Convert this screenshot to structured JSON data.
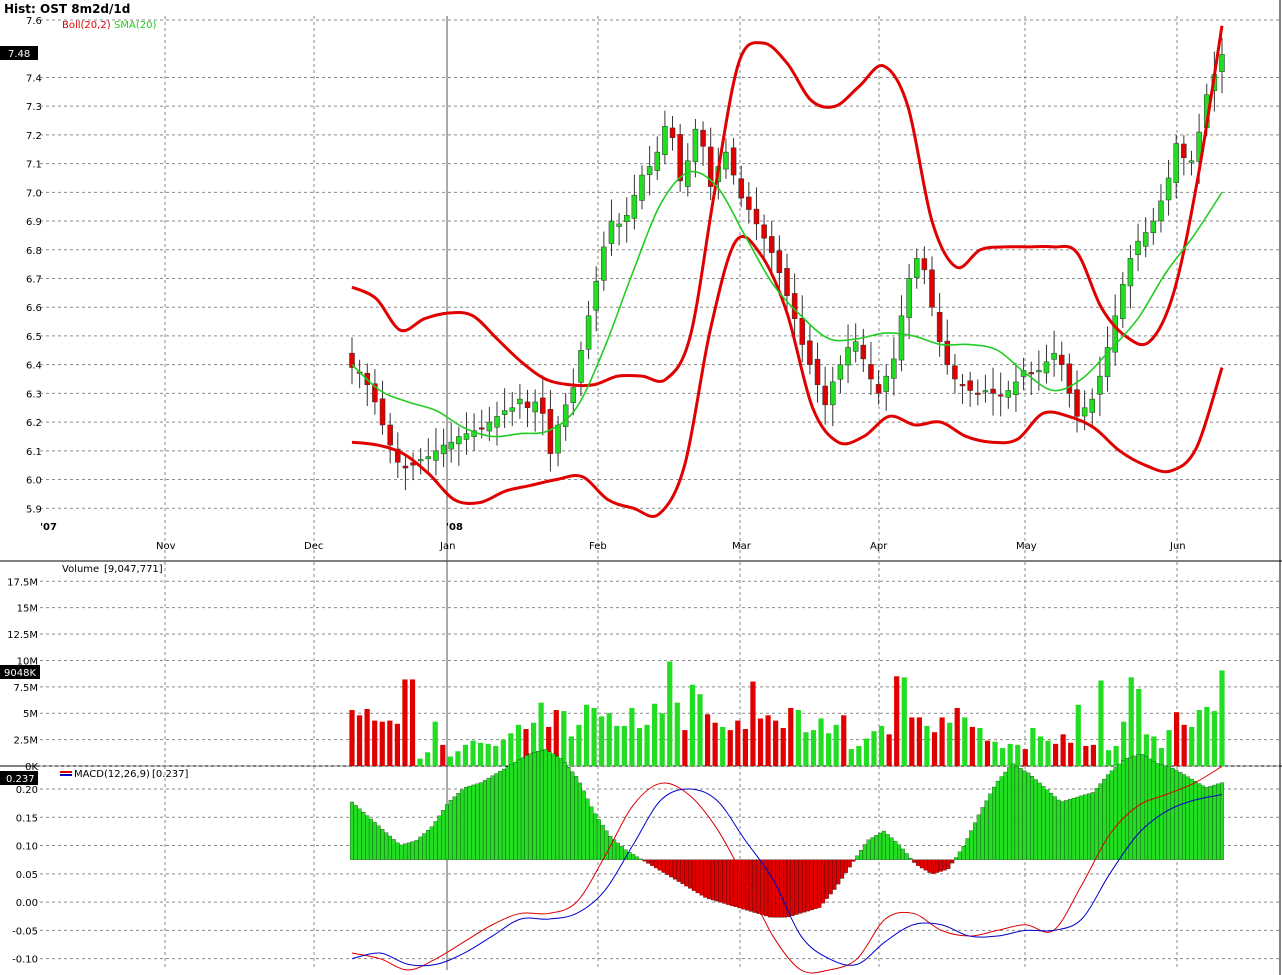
{
  "window": {
    "title": "Hist: OST 8m2d/1d"
  },
  "price_panel": {
    "legend": [
      {
        "label": "Boll(20,2)",
        "color": "#e00000"
      },
      {
        "label": "SMA(20)",
        "color": "#22cc22"
      }
    ],
    "last_value_badge": "7.48",
    "y_ticks": [
      "7.6",
      "7.4",
      "7.3",
      "7.2",
      "7.1",
      "7.0",
      "6.9",
      "6.8",
      "6.7",
      "6.6",
      "6.5",
      "6.4",
      "6.3",
      "6.2",
      "6.1",
      "6.0",
      "5.9"
    ]
  },
  "volume_panel": {
    "label": "Volume",
    "value": "[9,047,771]",
    "last_value_badge": "9048K",
    "y_ticks": [
      "17.5M",
      "15M",
      "12.5M",
      "10M",
      "7.5M",
      "5M",
      "2.5M",
      "0K"
    ]
  },
  "macd_panel": {
    "label": "MACD(12,26,9)",
    "value": "[0.237]",
    "last_value_badge": "0.237",
    "y_ticks": [
      "0.20",
      "0.15",
      "0.10",
      "0.05",
      "0.00",
      "-0.05",
      "-0.10"
    ]
  },
  "time_axis": {
    "year_labels": [
      "'07",
      "'08"
    ],
    "month_labels": [
      "Nov",
      "Dec",
      "Jan",
      "Feb",
      "Mar",
      "Apr",
      "May",
      "Jun"
    ]
  },
  "colors": {
    "up": "#22dd22",
    "down": "#e00000",
    "boll": "#e00000",
    "sma": "#22cc22",
    "macd": "#0000cc",
    "signal": "#dd0000"
  },
  "chart_data": [
    {
      "type": "candlestick",
      "title": "Hist: OST 8m2d/1d",
      "ylim": [
        5.88,
        7.6
      ],
      "grid": true,
      "x_range": [
        "2007-10-01",
        "2008-06-12"
      ],
      "close": [
        6.39,
        6.37,
        6.33,
        6.27,
        6.19,
        6.12,
        6.06,
        6.04,
        6.05,
        6.07,
        6.08,
        6.1,
        6.12,
        6.13,
        6.15,
        6.16,
        6.17,
        6.18,
        6.2,
        6.22,
        6.24,
        6.25,
        6.28,
        6.25,
        6.27,
        6.23,
        6.09,
        6.19,
        6.26,
        6.32,
        6.45,
        6.57,
        6.69,
        6.81,
        6.9,
        6.89,
        6.92,
        6.99,
        7.06,
        7.09,
        7.14,
        7.23,
        7.19,
        7.04,
        7.11,
        7.22,
        7.16,
        7.02,
        7.09,
        7.14,
        7.06,
        6.98,
        6.94,
        6.89,
        6.84,
        6.79,
        6.72,
        6.64,
        6.56,
        6.47,
        6.4,
        6.33,
        6.26,
        6.34,
        6.4,
        6.46,
        6.48,
        6.42,
        6.35,
        6.3,
        6.36,
        6.42,
        6.57,
        6.7,
        6.77,
        6.73,
        6.6,
        6.48,
        6.4,
        6.35,
        6.33,
        6.31,
        6.3,
        6.31,
        6.3,
        6.29,
        6.31,
        6.34,
        6.38,
        6.37,
        6.38,
        6.41,
        6.44,
        6.4,
        6.3,
        6.22,
        6.25,
        6.28,
        6.36,
        6.46,
        6.57,
        6.68,
        6.77,
        6.83,
        6.86,
        6.9,
        6.97,
        7.05,
        7.17,
        7.12,
        7.11,
        7.21,
        7.34,
        7.41,
        7.48
      ],
      "bollinger_upper": [
        6.67,
        6.63,
        6.52,
        6.56,
        6.58,
        6.57,
        6.49,
        6.41,
        6.35,
        6.33,
        6.33,
        6.36,
        6.36,
        6.35,
        6.5,
        7.0,
        7.45,
        7.52,
        7.45,
        7.32,
        7.3,
        7.37,
        7.44,
        7.3,
        6.9,
        6.74,
        6.8,
        6.81,
        6.81,
        6.81,
        6.79,
        6.6,
        6.5,
        6.48,
        6.65,
        7.05,
        7.58
      ],
      "sma": [
        6.4,
        6.31,
        6.27,
        6.24,
        6.18,
        6.15,
        6.16,
        6.17,
        6.25,
        6.46,
        6.72,
        6.96,
        7.07,
        7.02,
        6.85,
        6.68,
        6.57,
        6.49,
        6.49,
        6.51,
        6.5,
        6.47,
        6.47,
        6.45,
        6.37,
        6.31,
        6.35,
        6.45,
        6.56,
        6.72,
        6.85,
        7.0
      ],
      "bollinger_lower": [
        6.13,
        6.12,
        6.09,
        6.02,
        5.93,
        5.92,
        5.96,
        5.98,
        6.0,
        6.01,
        5.93,
        5.9,
        5.88,
        6.05,
        6.52,
        6.83,
        6.78,
        6.58,
        6.25,
        6.13,
        6.15,
        6.22,
        6.19,
        6.2,
        6.15,
        6.13,
        6.14,
        6.23,
        6.22,
        6.18,
        6.1,
        6.05,
        6.03,
        6.11,
        6.39
      ]
    },
    {
      "type": "bar",
      "title": "Volume",
      "ylim": [
        0,
        18000000
      ],
      "values": [
        5300000,
        4800000,
        5400000,
        4300000,
        4200000,
        4300000,
        4000000,
        8200000,
        8200000,
        700000,
        1300000,
        4200000,
        2000000,
        900000,
        1400000,
        2000000,
        2400000,
        2200000,
        2100000,
        1900000,
        2500000,
        3100000,
        3900000,
        3500000,
        4100000,
        6000000,
        3700000,
        5300000,
        5200000,
        2800000,
        3900000,
        5800000,
        5500000,
        4700000,
        5000000,
        3800000,
        3800000,
        5500000,
        3600000,
        3900000,
        5900000,
        5000000,
        9900000,
        6000000,
        3400000,
        7700000,
        6800000,
        4900000,
        4100000,
        3700000,
        3400000,
        4300000,
        3500000,
        8000000,
        4500000,
        4800000,
        4300000,
        3600000,
        5500000,
        5300000,
        3200000,
        3400000,
        4500000,
        3100000,
        3900000,
        4800000,
        1600000,
        1900000,
        2600000,
        3300000,
        3800000,
        3000000,
        8500000,
        8400000,
        4600000,
        4600000,
        3800000,
        3200000,
        4600000,
        4100000,
        5500000,
        4600000,
        3700000,
        3600000,
        2400000,
        2300000,
        1700000,
        2100000,
        2000000,
        1600000,
        3600000,
        2800000,
        2400000,
        2100000,
        3000000,
        2200000,
        5800000,
        1900000,
        2000000,
        8100000,
        1500000,
        1900000,
        4200000,
        8400000,
        7300000,
        3000000,
        2800000,
        1700000,
        3400000,
        5100000,
        3900000,
        3700000,
        5300000,
        5600000,
        5200000,
        9050000
      ],
      "up_days": [
        false,
        false,
        false,
        false,
        false,
        false,
        false,
        false,
        false,
        true,
        true,
        true,
        false,
        true,
        true,
        true,
        true,
        true,
        true,
        true,
        true,
        true,
        true,
        false,
        true,
        true,
        false,
        false,
        true,
        true,
        true,
        true,
        true,
        true,
        true,
        true,
        true,
        true,
        true,
        true,
        true,
        true,
        true,
        true,
        false,
        true,
        true,
        false,
        false,
        true,
        false,
        false,
        false,
        false,
        false,
        false,
        false,
        false,
        false,
        true,
        true,
        true,
        true,
        true,
        true,
        false,
        true,
        true,
        true,
        true,
        true,
        false,
        false,
        true,
        false,
        false,
        true,
        false,
        false,
        true,
        false,
        true,
        false,
        true,
        false,
        true,
        true,
        true,
        true,
        false,
        true,
        true,
        true,
        false,
        false,
        false,
        true,
        false,
        false,
        true,
        true,
        true,
        true,
        true,
        true,
        true,
        true,
        true,
        true,
        false,
        false,
        true,
        true,
        true,
        true,
        true
      ],
      "last_value": 9047771
    },
    {
      "type": "line",
      "title": "MACD(12,26,9)",
      "ylim": [
        -0.12,
        0.23
      ],
      "series": [
        {
          "name": "MACD(12,26,9)",
          "values": [
            -0.09,
            -0.1,
            -0.12,
            -0.1,
            -0.07,
            -0.04,
            -0.02,
            -0.02,
            0.0,
            0.08,
            0.17,
            0.21,
            0.19,
            0.13,
            0.04,
            -0.06,
            -0.12,
            -0.12,
            -0.1,
            -0.03,
            -0.02,
            -0.05,
            -0.06,
            -0.05,
            -0.04,
            -0.05,
            0.03,
            0.12,
            0.17,
            0.19,
            0.21,
            0.24
          ]
        },
        {
          "name": "Signal",
          "values": [
            -0.1,
            -0.09,
            -0.11,
            -0.11,
            -0.09,
            -0.06,
            -0.03,
            -0.03,
            -0.02,
            0.02,
            0.1,
            0.18,
            0.2,
            0.18,
            0.11,
            0.04,
            -0.06,
            -0.1,
            -0.11,
            -0.07,
            -0.04,
            -0.04,
            -0.06,
            -0.06,
            -0.05,
            -0.05,
            -0.03,
            0.05,
            0.12,
            0.16,
            0.18,
            0.19
          ]
        }
      ],
      "histogram": [
        0.12,
        0.09,
        0.06,
        0.03,
        0.04,
        0.07,
        0.12,
        0.15,
        0.16,
        0.18,
        0.2,
        0.22,
        0.23,
        0.21,
        0.17,
        0.1,
        0.05,
        0.02,
        0.0,
        -0.02,
        -0.04,
        -0.06,
        -0.08,
        -0.09,
        -0.1,
        -0.11,
        -0.12,
        -0.12,
        -0.11,
        -0.1,
        -0.06,
        -0.01,
        0.04,
        0.06,
        0.03,
        -0.01,
        -0.03,
        -0.02,
        0.03,
        0.1,
        0.16,
        0.2,
        0.18,
        0.15,
        0.12,
        0.13,
        0.14,
        0.18,
        0.21,
        0.22,
        0.2,
        0.19,
        0.17,
        0.15,
        0.16
      ],
      "last_value": 0.237
    }
  ]
}
